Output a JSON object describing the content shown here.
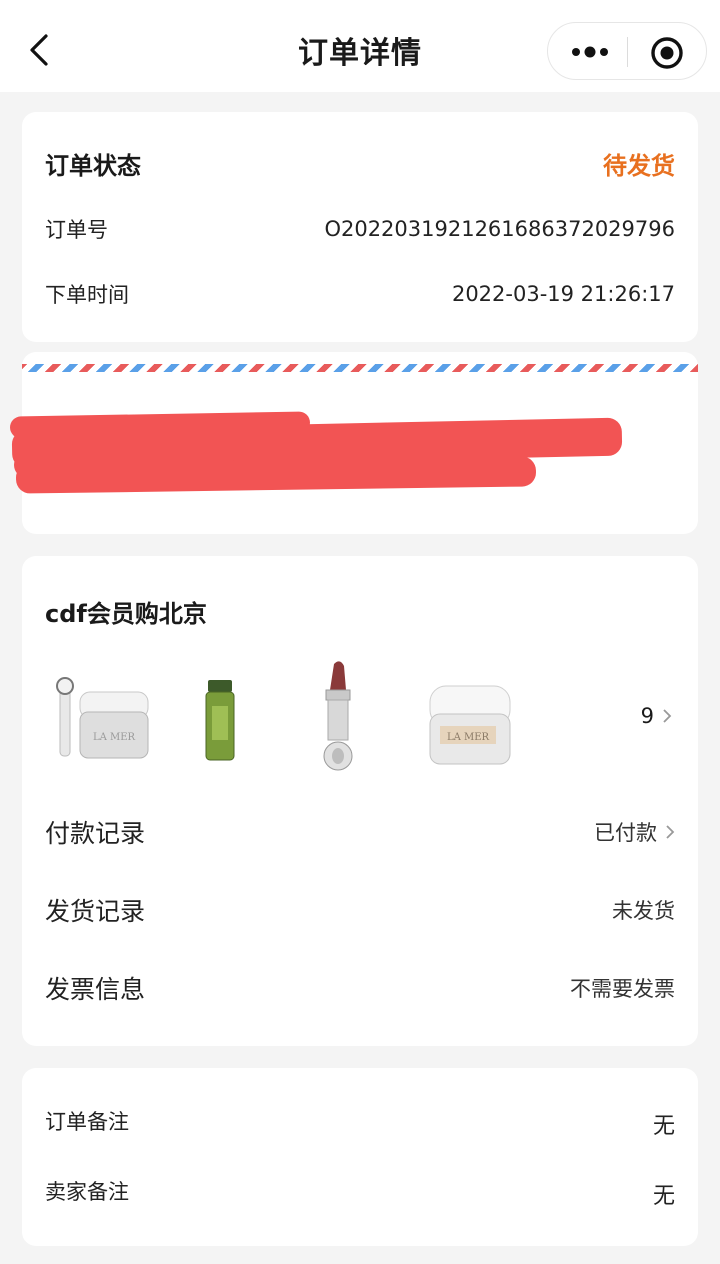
{
  "nav": {
    "title": "订单详情"
  },
  "status_card": {
    "status_label": "订单状态",
    "status_value": "待发货",
    "order_no_label": "订单号",
    "order_no_value": "O20220319212616863720​29796",
    "order_time_label": "下单时间",
    "order_time_value": "2022-03-19 21:26:17"
  },
  "goods_card": {
    "store_name": "cdf会员购北京",
    "item_count": "9",
    "payment_label": "付款记录",
    "payment_value": "已付款",
    "shipping_label": "发货记录",
    "shipping_value": "未发货",
    "invoice_label": "发票信息",
    "invoice_value": "不需要发票"
  },
  "notes_card": {
    "order_note_label": "订单备注",
    "order_note_value": "无",
    "seller_note_label": "卖家备注",
    "seller_note_value": "无"
  },
  "colors": {
    "accent_orange": "#e8701f",
    "redaction_red": "#f25454",
    "airmail_red": "#e85b5b",
    "airmail_blue": "#5aa0e8"
  },
  "icons": [
    "back-arrow-icon",
    "more-dots-icon",
    "close-target-icon",
    "chevron-right-icon"
  ]
}
